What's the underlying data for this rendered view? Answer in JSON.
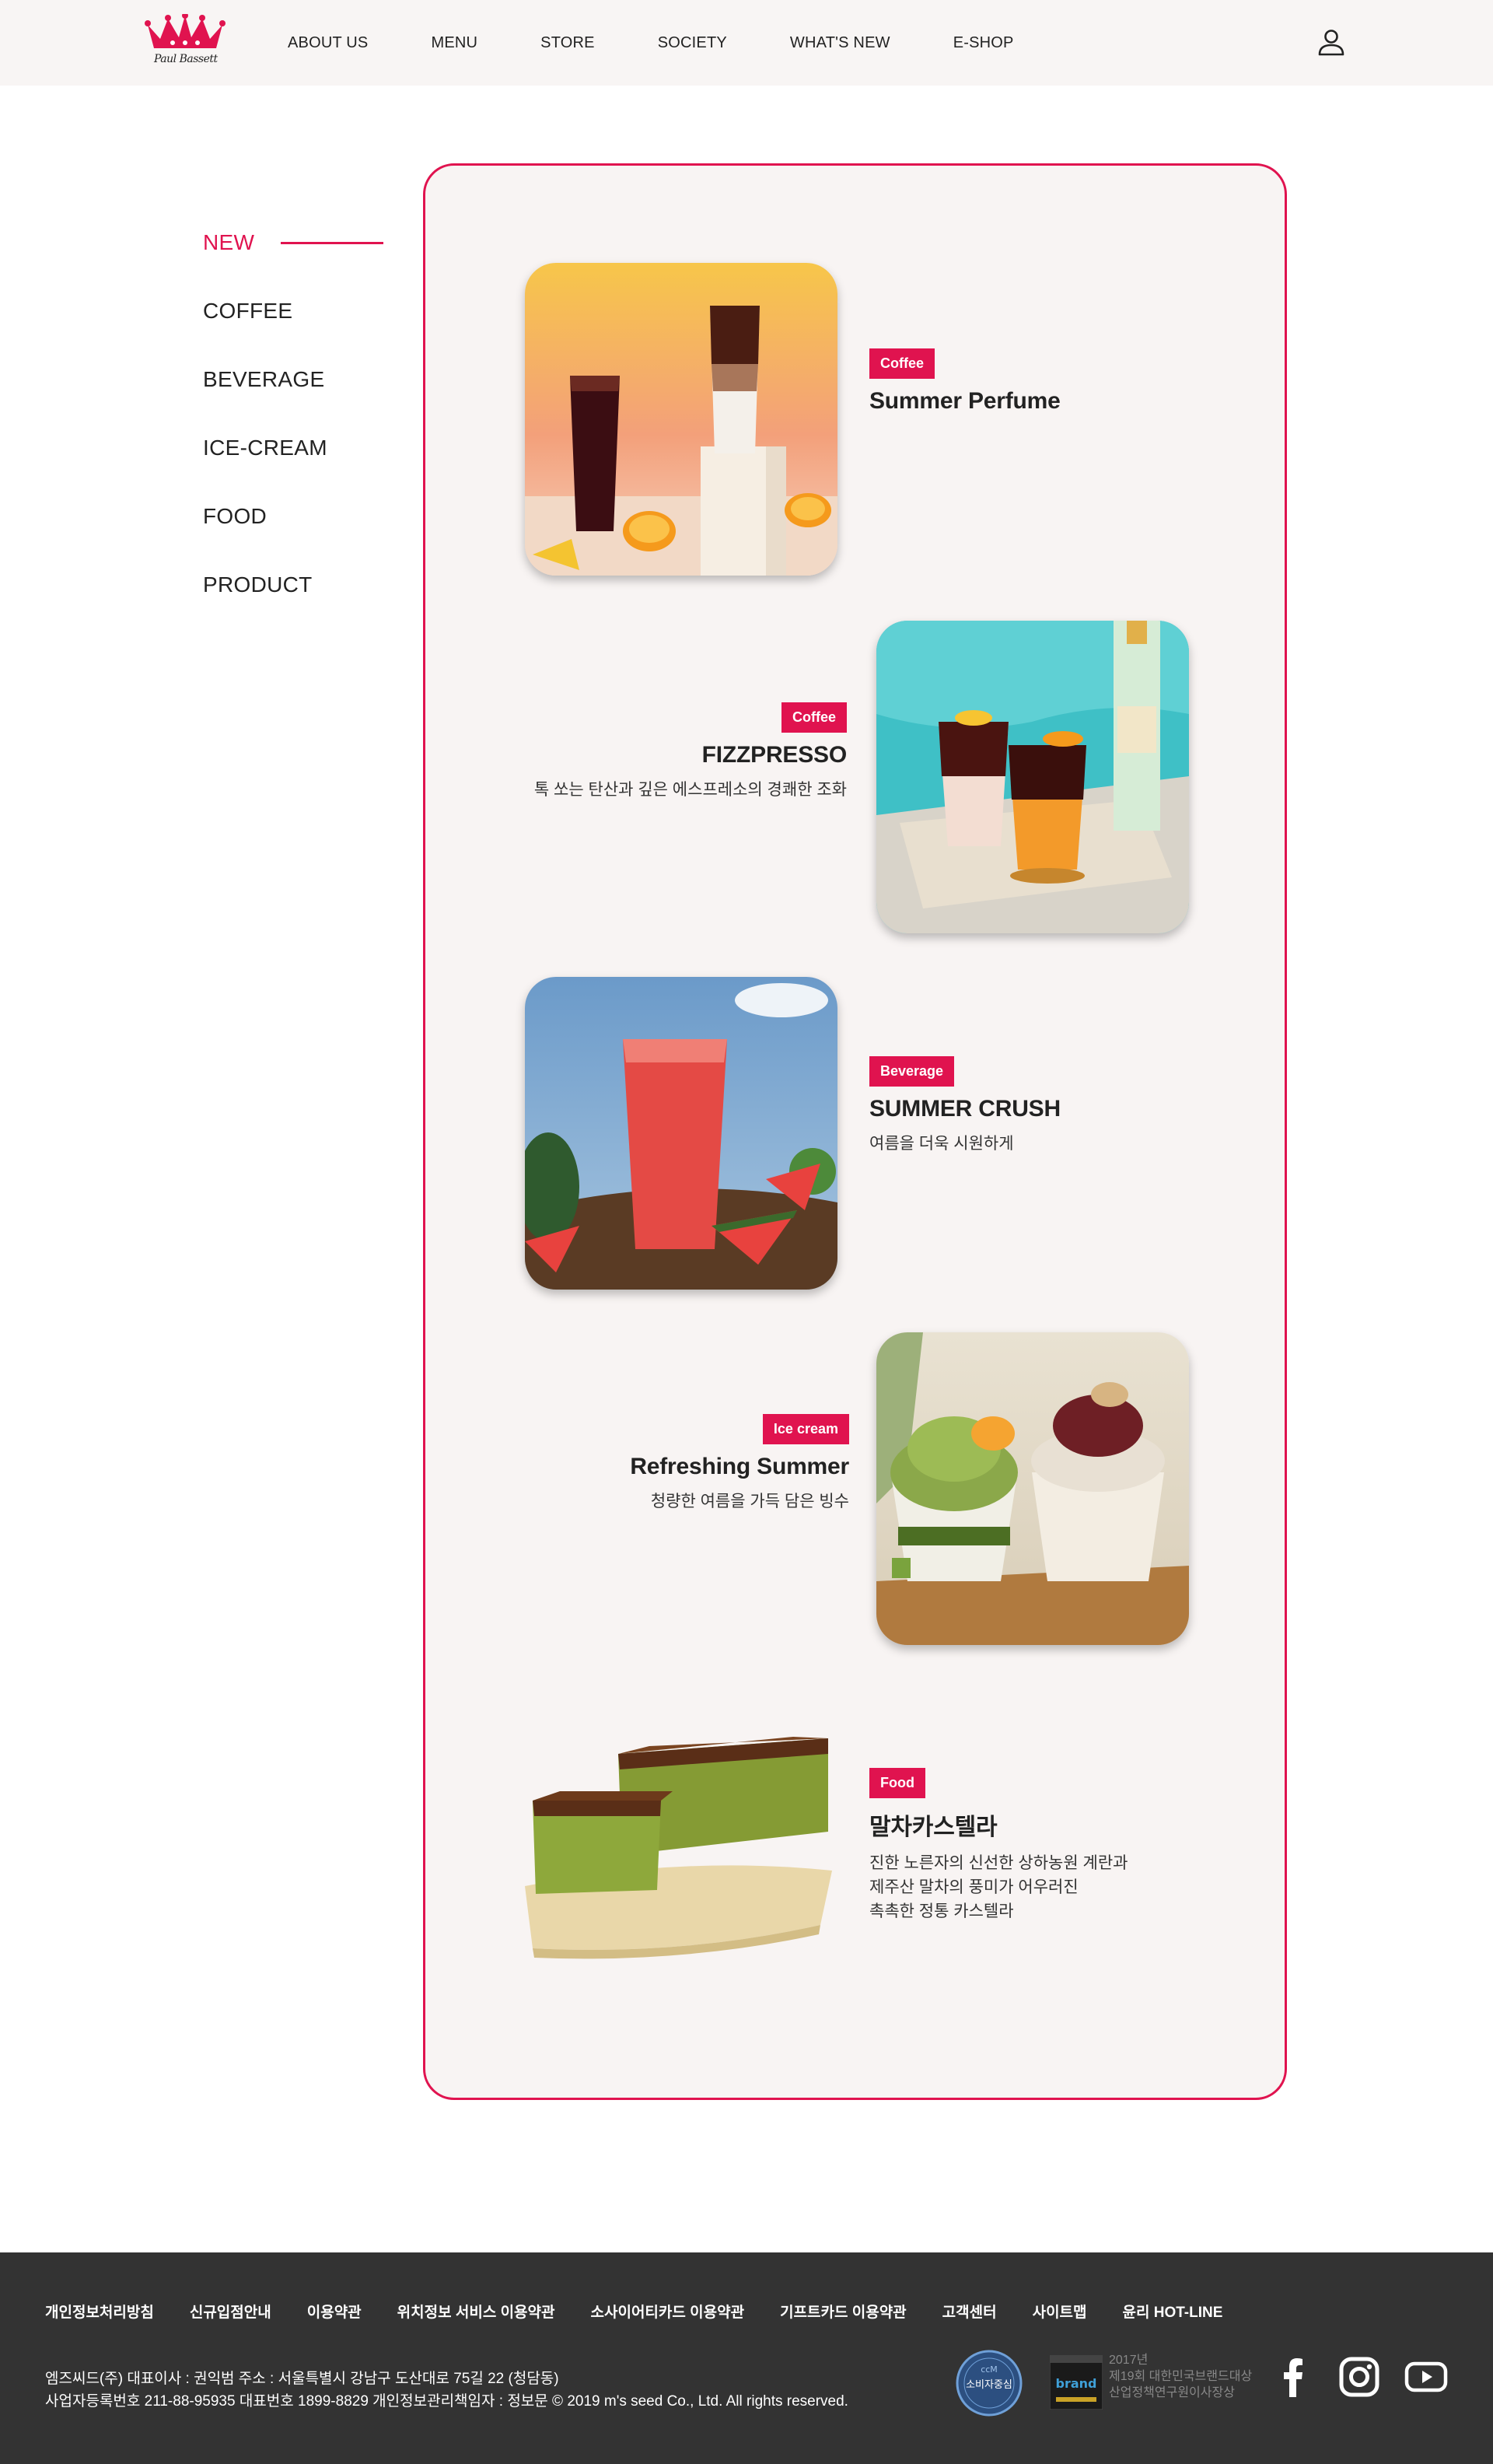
{
  "header": {
    "logo_text": "Paul Bassett",
    "nav": [
      "ABOUT US",
      "MENU",
      "STORE",
      "SOCIETY",
      "WHAT'S NEW",
      "E-SHOP"
    ],
    "user_icon": "user-icon"
  },
  "sidebar": {
    "items": [
      {
        "label": "NEW",
        "active": true
      },
      {
        "label": "COFFEE",
        "active": false
      },
      {
        "label": "BEVERAGE",
        "active": false
      },
      {
        "label": "ICE-CREAM",
        "active": false
      },
      {
        "label": "FOOD",
        "active": false
      },
      {
        "label": "PRODUCT",
        "active": false
      }
    ]
  },
  "products": [
    {
      "badge": "Coffee",
      "title": "Summer Perfume",
      "desc": ""
    },
    {
      "badge": "Coffee",
      "title": "FIZZPRESSO",
      "desc": "톡 쏘는 탄산과 깊은 에스프레소의 경쾌한 조화"
    },
    {
      "badge": "Beverage",
      "title": "SUMMER CRUSH",
      "desc": "여름을 더욱 시원하게"
    },
    {
      "badge": "Ice cream",
      "title": "Refreshing Summer",
      "desc": "청량한 여름을 가득 담은 빙수"
    },
    {
      "badge": "Food",
      "title": "말차카스텔라",
      "desc_lines": [
        "진한 노른자의 신선한 상하농원 계란과",
        "제주산 말차의 풍미가 어우러진",
        "촉촉한 정통 카스텔라"
      ]
    }
  ],
  "footer": {
    "links": [
      "개인정보처리방침",
      "신규입점안내",
      "이용약관",
      "위치정보 서비스 이용약관",
      "소사이어티카드 이용약관",
      "기프트카드 이용약관",
      "고객센터",
      "사이트맵",
      "윤리 HOT-LINE"
    ],
    "address_line1": "엠즈씨드(주) 대표이사 : 권익범 주소 : 서울특별시 강남구 도산대로 75길 22 (청담동)",
    "address_line2": "사업자등록번호 211-88-95935 대표번호 1899-8829 개인정보관리책임자 : 정보문 © 2019 m's seed Co., Ltd. All rights reserved.",
    "cert1_label": "소비자중심",
    "cert2_label": "brand",
    "award_year": "2017년",
    "award_line1": "제19회 대한민국브랜드대상",
    "award_line2": "산업정책연구원이사장상",
    "social": [
      "facebook-icon",
      "instagram-icon",
      "youtube-icon"
    ]
  },
  "colors": {
    "accent": "#e0134f",
    "panel_bg": "#f8f4f3",
    "footer_bg": "#333333"
  }
}
